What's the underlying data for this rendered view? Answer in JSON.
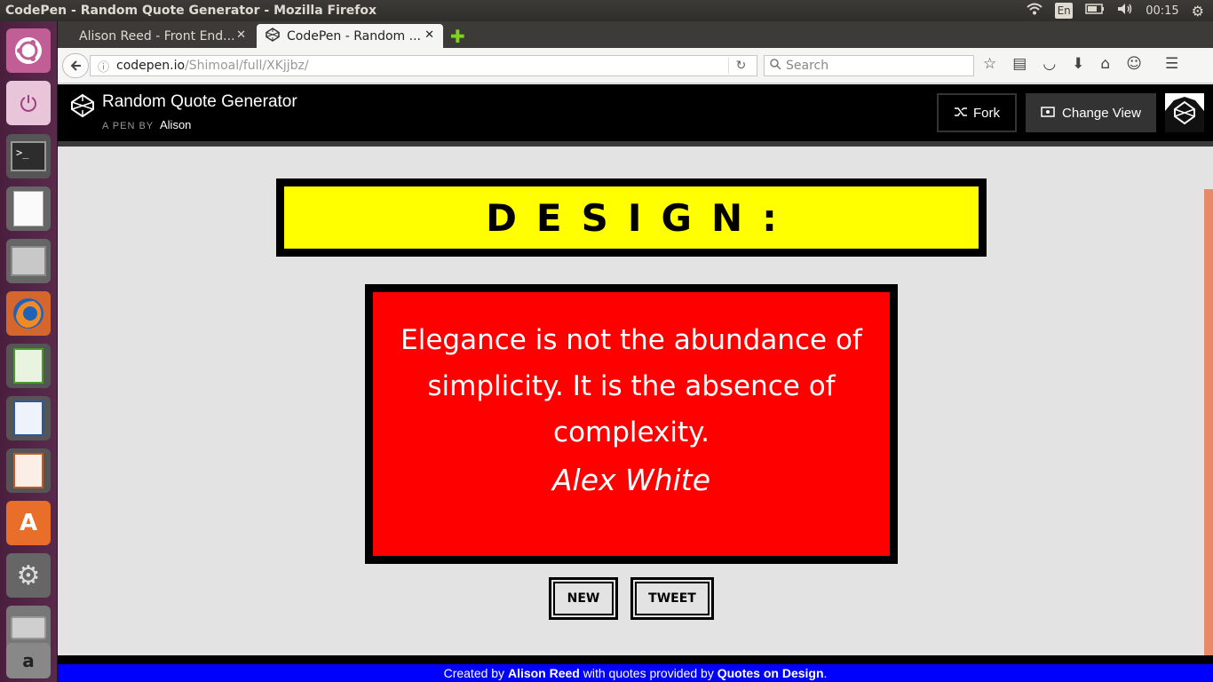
{
  "window_title": "CodePen - Random Quote Generator - Mozilla Firefox",
  "panel": {
    "keyboard": "En",
    "clock": "00:15"
  },
  "tabs": [
    {
      "label": "Alison Reed - Front End..."
    },
    {
      "label": "CodePen - Random ..."
    }
  ],
  "nav": {
    "url_host": "codepen.io",
    "url_path": "/Shimoal/full/XKjjbz/",
    "search_placeholder": "Search"
  },
  "codepen": {
    "pen_title": "Random Quote Generator",
    "pen_by": "A PEN BY",
    "author": "Alison",
    "fork_label": "Fork",
    "change_view_label": "Change View"
  },
  "app": {
    "heading": "DESIGN:",
    "quote": "Elegance is not the abundance of simplicity. It is the absence of complexity.",
    "quote_author": "Alex White",
    "new_button": "NEW",
    "tweet_button": "TWEET",
    "footer": {
      "prefix": "Created by",
      "creator": "Alison Reed",
      "middle": "with quotes provided by",
      "source": "Quotes on Design",
      "suffix": "."
    }
  },
  "colors": {
    "heading_bg": "#ffff00",
    "quote_bg": "#ff0000",
    "footer_bg": "#0000ff",
    "launcher_bg": "#5a2a4d"
  }
}
